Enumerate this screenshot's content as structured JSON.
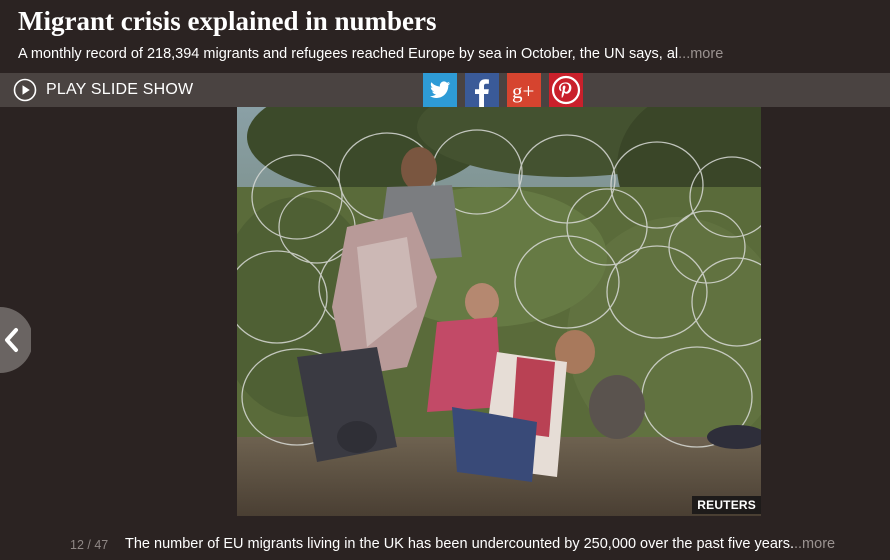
{
  "header": {
    "title": "Migrant crisis explained in numbers",
    "subtitle": "A monthly record of 218,394 migrants and refugees reached Europe by sea in October, the UN says, al",
    "more_label": "...more"
  },
  "toolbar": {
    "play_label": "PLAY SLIDE SHOW",
    "play_icon": "play-circle-icon",
    "share": [
      {
        "name": "Twitter",
        "icon": "twitter-bird-icon",
        "color": "#2e9bd6"
      },
      {
        "name": "Facebook",
        "icon": "facebook-f-icon",
        "color": "#3a5a98"
      },
      {
        "name": "Google+",
        "icon": "google-plus-icon",
        "color": "#d6442f",
        "glyph": "g+"
      },
      {
        "name": "Pinterest",
        "icon": "pinterest-p-icon",
        "color": "#c9202b"
      }
    ]
  },
  "slide": {
    "photo_credit": "REUTERS",
    "counter": "12 / 47",
    "caption": "The number of EU migrants living in the UK has been undercounted by 250,000 over the past five years.",
    "more_label": "..more"
  },
  "navigation": {
    "prev_icon": "chevron-left-icon"
  },
  "colors": {
    "background": "#2b2322",
    "toolbar": "#4a4341",
    "muted_text": "#9a9290"
  }
}
